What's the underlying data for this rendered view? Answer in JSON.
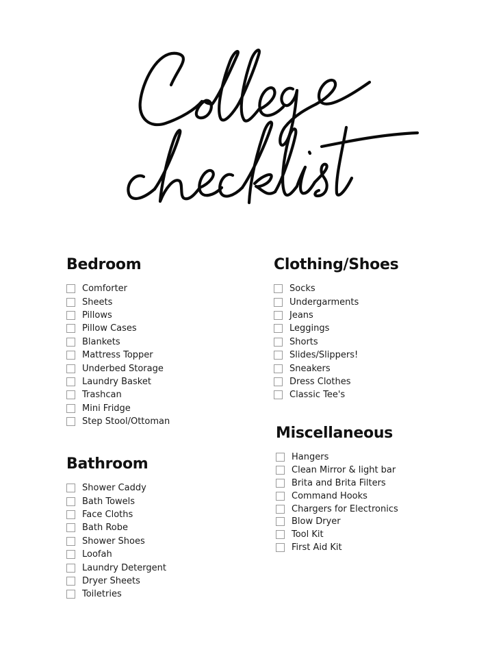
{
  "title": {
    "line1": "College",
    "line2": "checklist",
    "full": "College checklist"
  },
  "sections": {
    "bedroom": {
      "heading": "Bedroom",
      "items": [
        {
          "label": "Comforter",
          "checked": false
        },
        {
          "label": "Sheets",
          "checked": false
        },
        {
          "label": "Pillows",
          "checked": false
        },
        {
          "label": "Pillow Cases",
          "checked": false
        },
        {
          "label": "Blankets",
          "checked": false
        },
        {
          "label": "Mattress Topper",
          "checked": false
        },
        {
          "label": "Underbed Storage",
          "checked": false
        },
        {
          "label": "Laundry Basket",
          "checked": false
        },
        {
          "label": "Trashcan",
          "checked": false
        },
        {
          "label": "Mini Fridge",
          "checked": false
        },
        {
          "label": "Step Stool/Ottoman",
          "checked": false
        }
      ]
    },
    "bathroom": {
      "heading": "Bathroom",
      "items": [
        {
          "label": "Shower Caddy",
          "checked": false
        },
        {
          "label": "Bath Towels",
          "checked": false
        },
        {
          "label": "Face Cloths",
          "checked": false
        },
        {
          "label": "Bath Robe",
          "checked": false
        },
        {
          "label": "Shower Shoes",
          "checked": false
        },
        {
          "label": "Loofah",
          "checked": false
        },
        {
          "label": "Laundry Detergent",
          "checked": false
        },
        {
          "label": "Dryer Sheets",
          "checked": false
        },
        {
          "label": "Toiletries",
          "checked": false
        }
      ]
    },
    "clothing": {
      "heading": "Clothing/Shoes",
      "items": [
        {
          "label": "Socks",
          "checked": false
        },
        {
          "label": "Undergarments",
          "checked": false
        },
        {
          "label": "Jeans",
          "checked": false
        },
        {
          "label": "Leggings",
          "checked": false
        },
        {
          "label": "Shorts",
          "checked": false
        },
        {
          "label": "Slides/Slippers!",
          "checked": false
        },
        {
          "label": "Sneakers",
          "checked": false
        },
        {
          "label": "Dress Clothes",
          "checked": false
        },
        {
          "label": "Classic Tee's",
          "checked": false
        }
      ]
    },
    "misc": {
      "heading": "Miscellaneous",
      "items": [
        {
          "label": "Hangers",
          "checked": false
        },
        {
          "label": "Clean Mirror & light bar",
          "checked": false
        },
        {
          "label": "Brita and Brita Filters",
          "checked": false
        },
        {
          "label": "Command Hooks",
          "checked": false
        },
        {
          "label": "Chargers for Electronics",
          "checked": false
        },
        {
          "label": "Blow Dryer",
          "checked": false
        },
        {
          "label": "Tool Kit",
          "checked": false
        },
        {
          "label": "First Aid Kit",
          "checked": false
        }
      ]
    }
  }
}
